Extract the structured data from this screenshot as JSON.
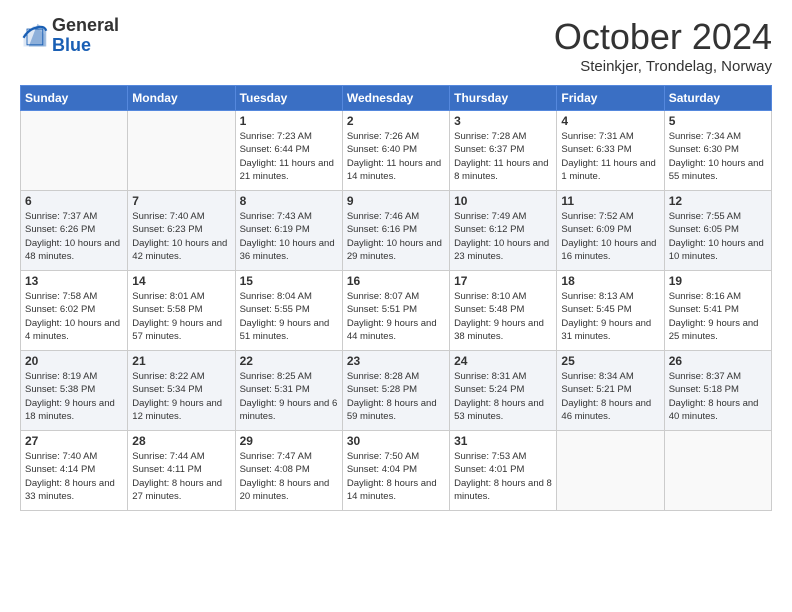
{
  "logo": {
    "general": "General",
    "blue": "Blue"
  },
  "header": {
    "month": "October 2024",
    "location": "Steinkjer, Trondelag, Norway"
  },
  "weekdays": [
    "Sunday",
    "Monday",
    "Tuesday",
    "Wednesday",
    "Thursday",
    "Friday",
    "Saturday"
  ],
  "weeks": [
    [
      {
        "day": "",
        "text": ""
      },
      {
        "day": "",
        "text": ""
      },
      {
        "day": "1",
        "text": "Sunrise: 7:23 AM\nSunset: 6:44 PM\nDaylight: 11 hours and 21 minutes."
      },
      {
        "day": "2",
        "text": "Sunrise: 7:26 AM\nSunset: 6:40 PM\nDaylight: 11 hours and 14 minutes."
      },
      {
        "day": "3",
        "text": "Sunrise: 7:28 AM\nSunset: 6:37 PM\nDaylight: 11 hours and 8 minutes."
      },
      {
        "day": "4",
        "text": "Sunrise: 7:31 AM\nSunset: 6:33 PM\nDaylight: 11 hours and 1 minute."
      },
      {
        "day": "5",
        "text": "Sunrise: 7:34 AM\nSunset: 6:30 PM\nDaylight: 10 hours and 55 minutes."
      }
    ],
    [
      {
        "day": "6",
        "text": "Sunrise: 7:37 AM\nSunset: 6:26 PM\nDaylight: 10 hours and 48 minutes."
      },
      {
        "day": "7",
        "text": "Sunrise: 7:40 AM\nSunset: 6:23 PM\nDaylight: 10 hours and 42 minutes."
      },
      {
        "day": "8",
        "text": "Sunrise: 7:43 AM\nSunset: 6:19 PM\nDaylight: 10 hours and 36 minutes."
      },
      {
        "day": "9",
        "text": "Sunrise: 7:46 AM\nSunset: 6:16 PM\nDaylight: 10 hours and 29 minutes."
      },
      {
        "day": "10",
        "text": "Sunrise: 7:49 AM\nSunset: 6:12 PM\nDaylight: 10 hours and 23 minutes."
      },
      {
        "day": "11",
        "text": "Sunrise: 7:52 AM\nSunset: 6:09 PM\nDaylight: 10 hours and 16 minutes."
      },
      {
        "day": "12",
        "text": "Sunrise: 7:55 AM\nSunset: 6:05 PM\nDaylight: 10 hours and 10 minutes."
      }
    ],
    [
      {
        "day": "13",
        "text": "Sunrise: 7:58 AM\nSunset: 6:02 PM\nDaylight: 10 hours and 4 minutes."
      },
      {
        "day": "14",
        "text": "Sunrise: 8:01 AM\nSunset: 5:58 PM\nDaylight: 9 hours and 57 minutes."
      },
      {
        "day": "15",
        "text": "Sunrise: 8:04 AM\nSunset: 5:55 PM\nDaylight: 9 hours and 51 minutes."
      },
      {
        "day": "16",
        "text": "Sunrise: 8:07 AM\nSunset: 5:51 PM\nDaylight: 9 hours and 44 minutes."
      },
      {
        "day": "17",
        "text": "Sunrise: 8:10 AM\nSunset: 5:48 PM\nDaylight: 9 hours and 38 minutes."
      },
      {
        "day": "18",
        "text": "Sunrise: 8:13 AM\nSunset: 5:45 PM\nDaylight: 9 hours and 31 minutes."
      },
      {
        "day": "19",
        "text": "Sunrise: 8:16 AM\nSunset: 5:41 PM\nDaylight: 9 hours and 25 minutes."
      }
    ],
    [
      {
        "day": "20",
        "text": "Sunrise: 8:19 AM\nSunset: 5:38 PM\nDaylight: 9 hours and 18 minutes."
      },
      {
        "day": "21",
        "text": "Sunrise: 8:22 AM\nSunset: 5:34 PM\nDaylight: 9 hours and 12 minutes."
      },
      {
        "day": "22",
        "text": "Sunrise: 8:25 AM\nSunset: 5:31 PM\nDaylight: 9 hours and 6 minutes."
      },
      {
        "day": "23",
        "text": "Sunrise: 8:28 AM\nSunset: 5:28 PM\nDaylight: 8 hours and 59 minutes."
      },
      {
        "day": "24",
        "text": "Sunrise: 8:31 AM\nSunset: 5:24 PM\nDaylight: 8 hours and 53 minutes."
      },
      {
        "day": "25",
        "text": "Sunrise: 8:34 AM\nSunset: 5:21 PM\nDaylight: 8 hours and 46 minutes."
      },
      {
        "day": "26",
        "text": "Sunrise: 8:37 AM\nSunset: 5:18 PM\nDaylight: 8 hours and 40 minutes."
      }
    ],
    [
      {
        "day": "27",
        "text": "Sunrise: 7:40 AM\nSunset: 4:14 PM\nDaylight: 8 hours and 33 minutes."
      },
      {
        "day": "28",
        "text": "Sunrise: 7:44 AM\nSunset: 4:11 PM\nDaylight: 8 hours and 27 minutes."
      },
      {
        "day": "29",
        "text": "Sunrise: 7:47 AM\nSunset: 4:08 PM\nDaylight: 8 hours and 20 minutes."
      },
      {
        "day": "30",
        "text": "Sunrise: 7:50 AM\nSunset: 4:04 PM\nDaylight: 8 hours and 14 minutes."
      },
      {
        "day": "31",
        "text": "Sunrise: 7:53 AM\nSunset: 4:01 PM\nDaylight: 8 hours and 8 minutes."
      },
      {
        "day": "",
        "text": ""
      },
      {
        "day": "",
        "text": ""
      }
    ]
  ]
}
